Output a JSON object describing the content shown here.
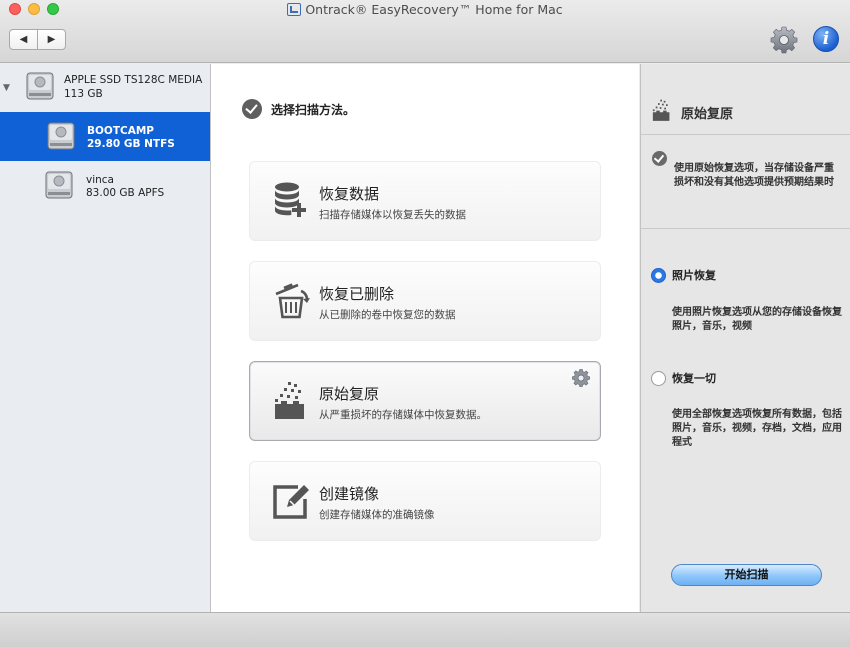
{
  "window": {
    "title": "Ontrack® EasyRecovery™ Home for Mac"
  },
  "toolbar": {
    "back_label": "◀",
    "forward_label": "▶"
  },
  "sidebar": {
    "disks": [
      {
        "name": "APPLE SSD TS128C MEDIA",
        "detail": "113  GB"
      },
      {
        "name": "BOOTCAMP",
        "detail": "29.80 GB NTFS",
        "selected": true
      },
      {
        "name": "vinca",
        "detail": "83.00 GB APFS"
      }
    ]
  },
  "main": {
    "heading": "选择扫描方法。",
    "options": [
      {
        "title": "恢复数据",
        "desc": "扫描存储媒体以恢复丢失的数据",
        "icon": "database-add-icon"
      },
      {
        "title": "恢复已删除",
        "desc": "从已删除的卷中恢复您的数据",
        "icon": "trash-restore-icon"
      },
      {
        "title": "原始复原",
        "desc": "从严重损坏的存储媒体中恢复数据。",
        "icon": "raw-recovery-icon",
        "active": true
      },
      {
        "title": "创建镜像",
        "desc": "创建存储媒体的准确镜像",
        "icon": "edit-image-icon"
      }
    ]
  },
  "panel": {
    "title": "原始复原",
    "info": "使用原始恢复选项，当存储设备严重损坏和没有其他选项提供预期结果时",
    "radio_photo_label": "照片恢复",
    "radio_photo_desc": "使用照片恢复选项从您的存储设备恢复照片，音乐，视频",
    "radio_all_label": "恢复一切",
    "radio_all_desc": "使用全部恢复选项恢复所有数据，包括照片，音乐，视频，存档，文档，应用程式",
    "start_button": "开始扫描"
  },
  "colors": {
    "selection": "#1061d6",
    "accent": "#2b77e4"
  }
}
